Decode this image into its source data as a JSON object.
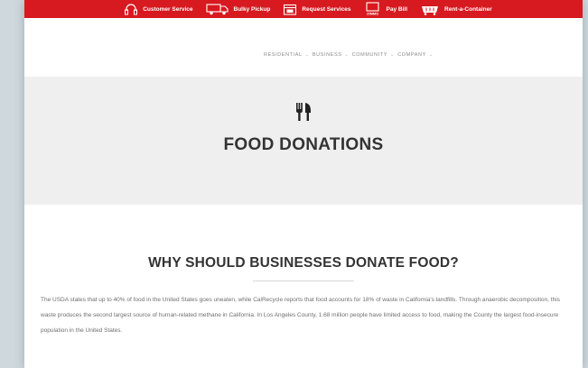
{
  "topbar": {
    "color": "#d71920",
    "items": [
      {
        "label": "Customer Service",
        "icon": "headset-icon"
      },
      {
        "label": "Bulky Pickup",
        "icon": "truck-icon"
      },
      {
        "label": "Request Services",
        "icon": "calendar-icon"
      },
      {
        "label": "Pay Bill",
        "icon": "payment-device-icon",
        "icon_text": "ZIMMS"
      },
      {
        "label": "Rent-a-Container",
        "icon": "container-icon"
      }
    ]
  },
  "nav": {
    "items": [
      {
        "label": "RESIDENTIAL"
      },
      {
        "label": "BUSINESS"
      },
      {
        "label": "COMMUNITY"
      },
      {
        "label": "COMPANY"
      }
    ],
    "caret": "⌄"
  },
  "hero": {
    "icon": "fork-knife-icon",
    "title": "FOOD DONATIONS"
  },
  "section": {
    "heading": "WHY SHOULD BUSINESSES DONATE FOOD?",
    "paragraph": "The USDA states that up to 40% of food in the United States goes uneaten, while CalRecycle reports that food accounts for 18% of waste in California's landfills. Through anaerobic decomposition, this waste produces the second largest source of human-related methane in California. In Los Angeles County, 1.68 million people have limited access to food, making the County the largest food-insecure population in the United States."
  }
}
